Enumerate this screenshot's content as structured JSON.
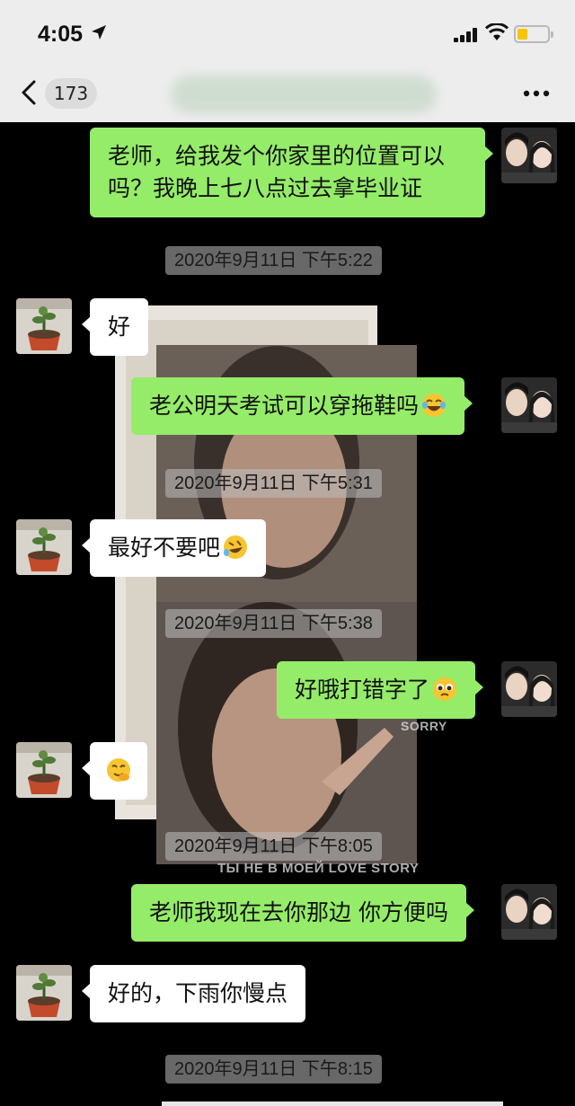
{
  "status_bar": {
    "time": "4:05",
    "icons": [
      "location-arrow-icon",
      "signal-icon",
      "wifi-icon",
      "battery-icon"
    ],
    "battery_level": 0.35
  },
  "nav": {
    "unread_count": "173",
    "icons": [
      "back-icon",
      "more-icon"
    ]
  },
  "colors": {
    "sent_bubble": "#95ec69",
    "received_bubble": "#ffffff",
    "header_bg": "#ededed",
    "chat_bg": "#000000"
  },
  "messages": [
    {
      "type": "sent",
      "text": "老师，给我发个你家里的位置可以吗？我晚上七八点过去拿毕业证"
    },
    {
      "type": "timestamp",
      "text": "2020年9月11日 下午5:22"
    },
    {
      "type": "received",
      "text": "好"
    },
    {
      "type": "sent",
      "text": "老公明天考试可以穿拖鞋吗",
      "emoji": "laughing-tears-emoji"
    },
    {
      "type": "timestamp",
      "text": "2020年9月11日 下午5:31"
    },
    {
      "type": "received",
      "text": "最好不要吧",
      "emoji": "rolling-laugh-emoji"
    },
    {
      "type": "timestamp",
      "text": "2020年9月11日 下午5:38"
    },
    {
      "type": "sent",
      "text": "好哦打错字了",
      "emoji": "pleading-emoji"
    },
    {
      "type": "received",
      "text": "",
      "emoji": "chuckle-emoji"
    },
    {
      "type": "timestamp",
      "text": "2020年9月11日 下午8:05"
    },
    {
      "type": "sent",
      "text": "老师我现在去你那边 你方便吗"
    },
    {
      "type": "received",
      "text": "好的，下雨你慢点"
    },
    {
      "type": "timestamp",
      "text": "2020年9月11日 下午8:15"
    }
  ],
  "sent_line_1": "老师，给我发个你家里的位置可以",
  "sent_line_2": "吗？我晚上七八点过去拿毕业证",
  "overlay": {
    "caption_sorry": "SORRY",
    "caption_story": "ТЫ НЕ В МОЕЙ LOVE STORY"
  },
  "avatars": {
    "self": "couple-avatar",
    "contact": "potted-plant-avatar"
  }
}
